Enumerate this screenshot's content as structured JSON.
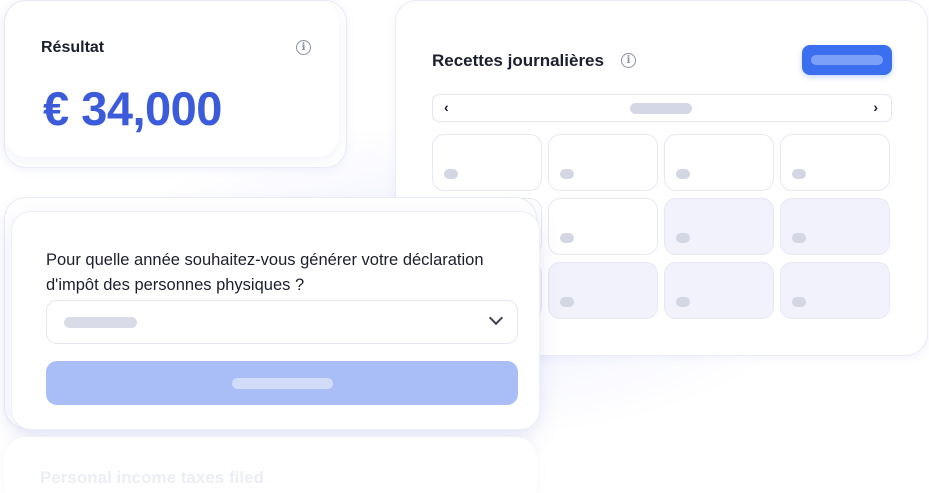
{
  "result": {
    "title": "Résultat",
    "value": "€ 34,000",
    "info_icon": "info-icon"
  },
  "daily": {
    "title": "Recettes journalières",
    "info_icon": "info-icon",
    "nav_prev": "‹",
    "nav_next": "›",
    "grid": {
      "rows": 3,
      "columns": 4
    }
  },
  "question": {
    "text": "Pour quelle année souhaitez-vous générer votre déclaration d'impôt des personnes physiques ?",
    "select_icon": "chevron-down-icon"
  },
  "bottom": {
    "text": "Personal income taxes filed"
  },
  "colors": {
    "accent": "#3b5bdb",
    "button": "#3b6ff0",
    "button_disabled": "#a9bdf6"
  }
}
